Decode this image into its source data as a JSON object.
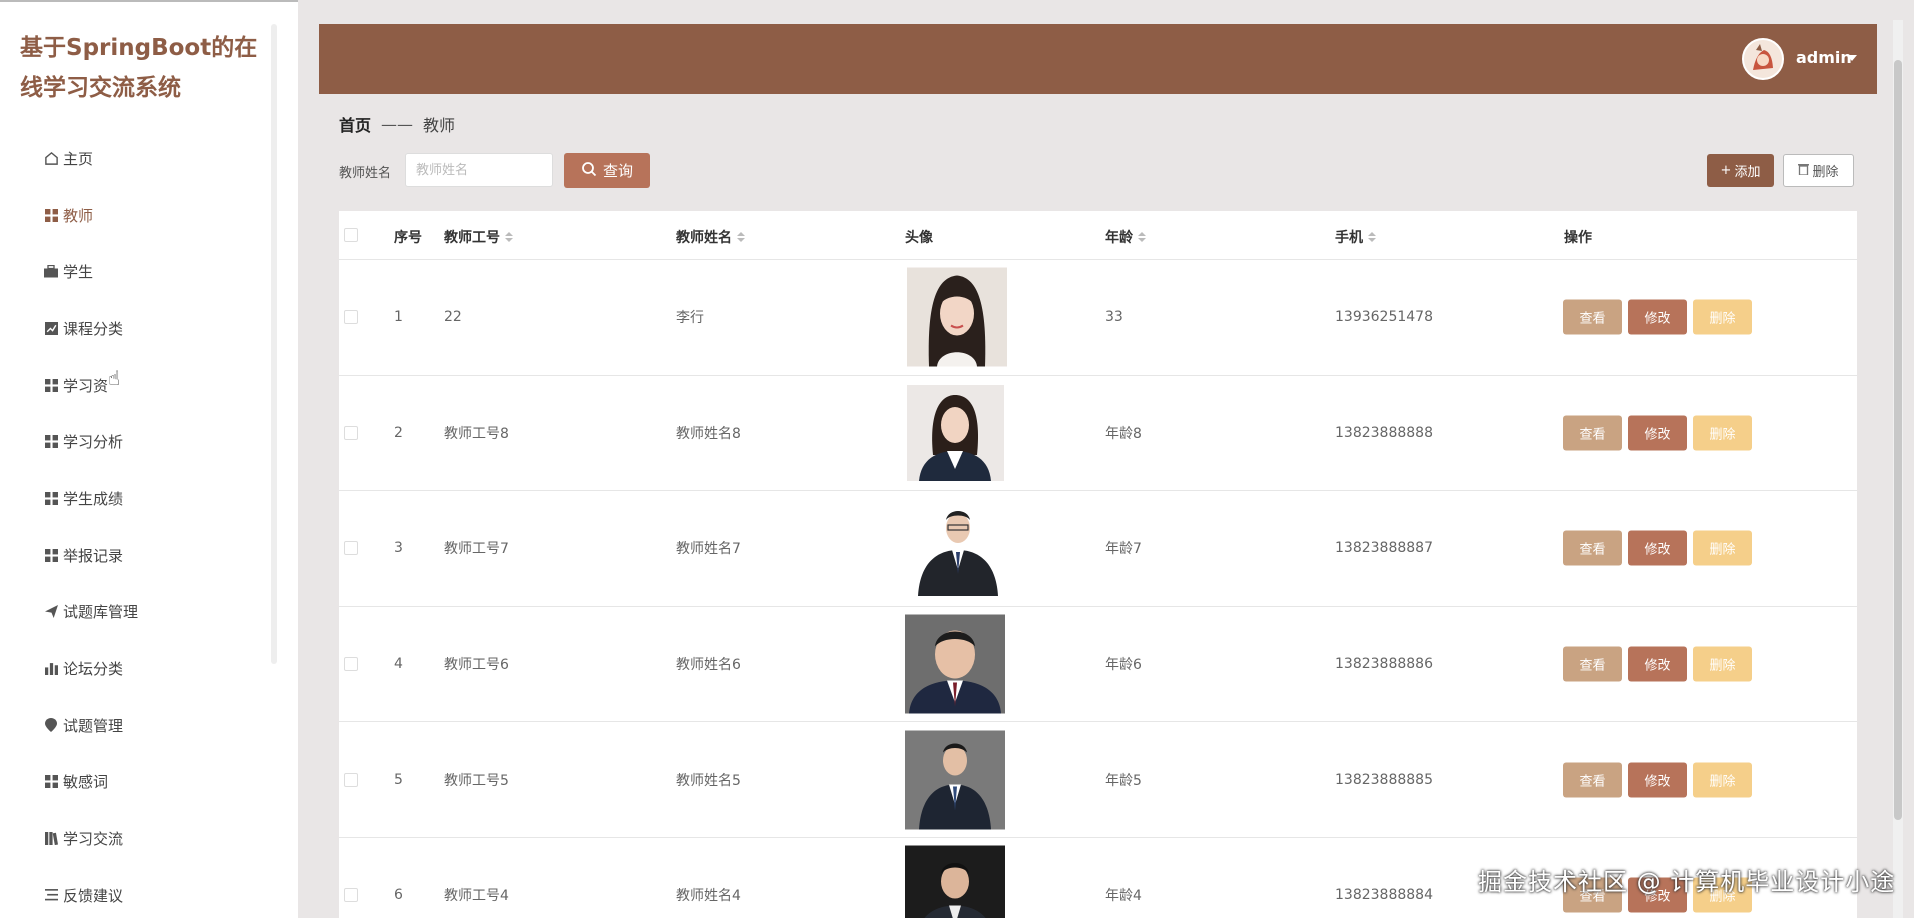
{
  "app": {
    "title": "基于SpringBoot的在线学习交流系统"
  },
  "sidebar": {
    "items": [
      {
        "label": "主页",
        "icon": "home-icon"
      },
      {
        "label": "教师",
        "icon": "grid-icon",
        "active": true
      },
      {
        "label": "学生",
        "icon": "briefcase-icon"
      },
      {
        "label": "课程分类",
        "icon": "chart-box-icon"
      },
      {
        "label": "学习资",
        "icon": "grid-icon"
      },
      {
        "label": "学习分析",
        "icon": "grid-icon"
      },
      {
        "label": "学生成绩",
        "icon": "grid-icon"
      },
      {
        "label": "举报记录",
        "icon": "grid-icon"
      },
      {
        "label": "试题库管理",
        "icon": "send-icon"
      },
      {
        "label": "论坛分类",
        "icon": "bar-chart-icon"
      },
      {
        "label": "试题管理",
        "icon": "location-pin-icon"
      },
      {
        "label": "敏感词",
        "icon": "grid-icon"
      },
      {
        "label": "学习交流",
        "icon": "books-icon"
      },
      {
        "label": "反馈建议",
        "icon": "list-icon"
      }
    ]
  },
  "header": {
    "username": "admin"
  },
  "breadcrumb": {
    "home": "首页",
    "separator": "——",
    "current": "教师"
  },
  "search": {
    "label": "教师姓名",
    "placeholder": "教师姓名",
    "query_label": "查询"
  },
  "toolbar": {
    "add_label": "添加",
    "delete_label": "删除"
  },
  "table": {
    "headers": {
      "index": "序号",
      "code": "教师工号",
      "name": "教师姓名",
      "avatar": "头像",
      "age": "年龄",
      "phone": "手机",
      "ops": "操作"
    },
    "rows": [
      {
        "index": "1",
        "code": "22",
        "name": "李行",
        "age": "33",
        "phone": "13936251478"
      },
      {
        "index": "2",
        "code": "教师工号8",
        "name": "教师姓名8",
        "age": "年龄8",
        "phone": "13823888888"
      },
      {
        "index": "3",
        "code": "教师工号7",
        "name": "教师姓名7",
        "age": "年龄7",
        "phone": "13823888887"
      },
      {
        "index": "4",
        "code": "教师工号6",
        "name": "教师姓名6",
        "age": "年龄6",
        "phone": "13823888886"
      },
      {
        "index": "5",
        "code": "教师工号5",
        "name": "教师姓名5",
        "age": "年龄5",
        "phone": "13823888885"
      },
      {
        "index": "6",
        "code": "教师工号4",
        "name": "教师姓名4",
        "age": "年龄4",
        "phone": "13823888884"
      }
    ],
    "op_labels": {
      "view": "查看",
      "edit": "修改",
      "remove": "删除"
    }
  },
  "watermark": "掘金技术社区 @ 计算机毕业设计小途",
  "colors": {
    "brand": "#8e5d46",
    "query": "#b7735a",
    "view": "#c9a382",
    "edit": "#b7735a",
    "remove": "#f5cf8a"
  }
}
